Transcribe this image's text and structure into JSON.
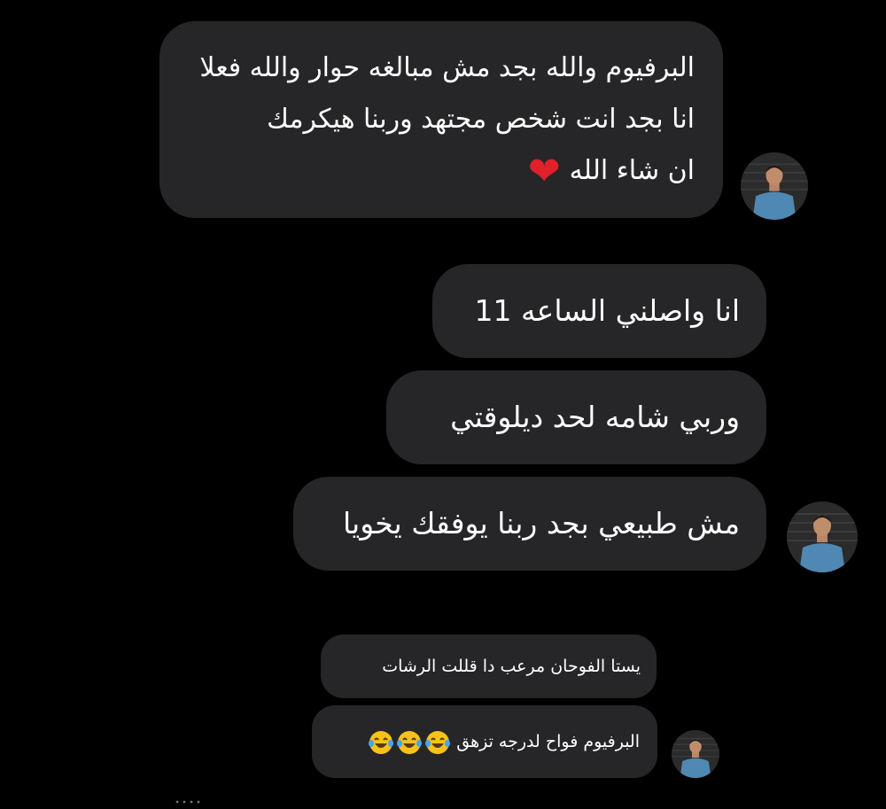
{
  "messages": [
    {
      "id": "b1",
      "lines": [
        "البرفيوم والله بجد مش مبالغه حوار والله فعلا",
        "انا بجد انت شخص مجتهد وربنا هيكرمك",
        "ان شاء الله"
      ],
      "emoji": "❤️"
    },
    {
      "id": "b2",
      "text": "انا واصلني الساعه 11"
    },
    {
      "id": "b3",
      "text": "وربي شامه لحد ديلوقتي"
    },
    {
      "id": "b4",
      "text": "مش طبيعي بجد ربنا يوفقك يخويا"
    },
    {
      "id": "b5",
      "text": "يستا الفوحان مرعب دا قللت الرشات"
    },
    {
      "id": "b6",
      "text": "البرفيوم فواح لدرجه تزهق",
      "emoji": "😂😂😂"
    }
  ],
  "icons": {
    "avatar": "avatar-icon",
    "heart": "red-heart-icon",
    "laugh": "tears-of-joy-icon"
  },
  "colors": {
    "background": "#000000",
    "bubble": "#262628",
    "text": "#ffffff",
    "heart": "#e0202a",
    "laugh_face": "#f7c21a"
  }
}
